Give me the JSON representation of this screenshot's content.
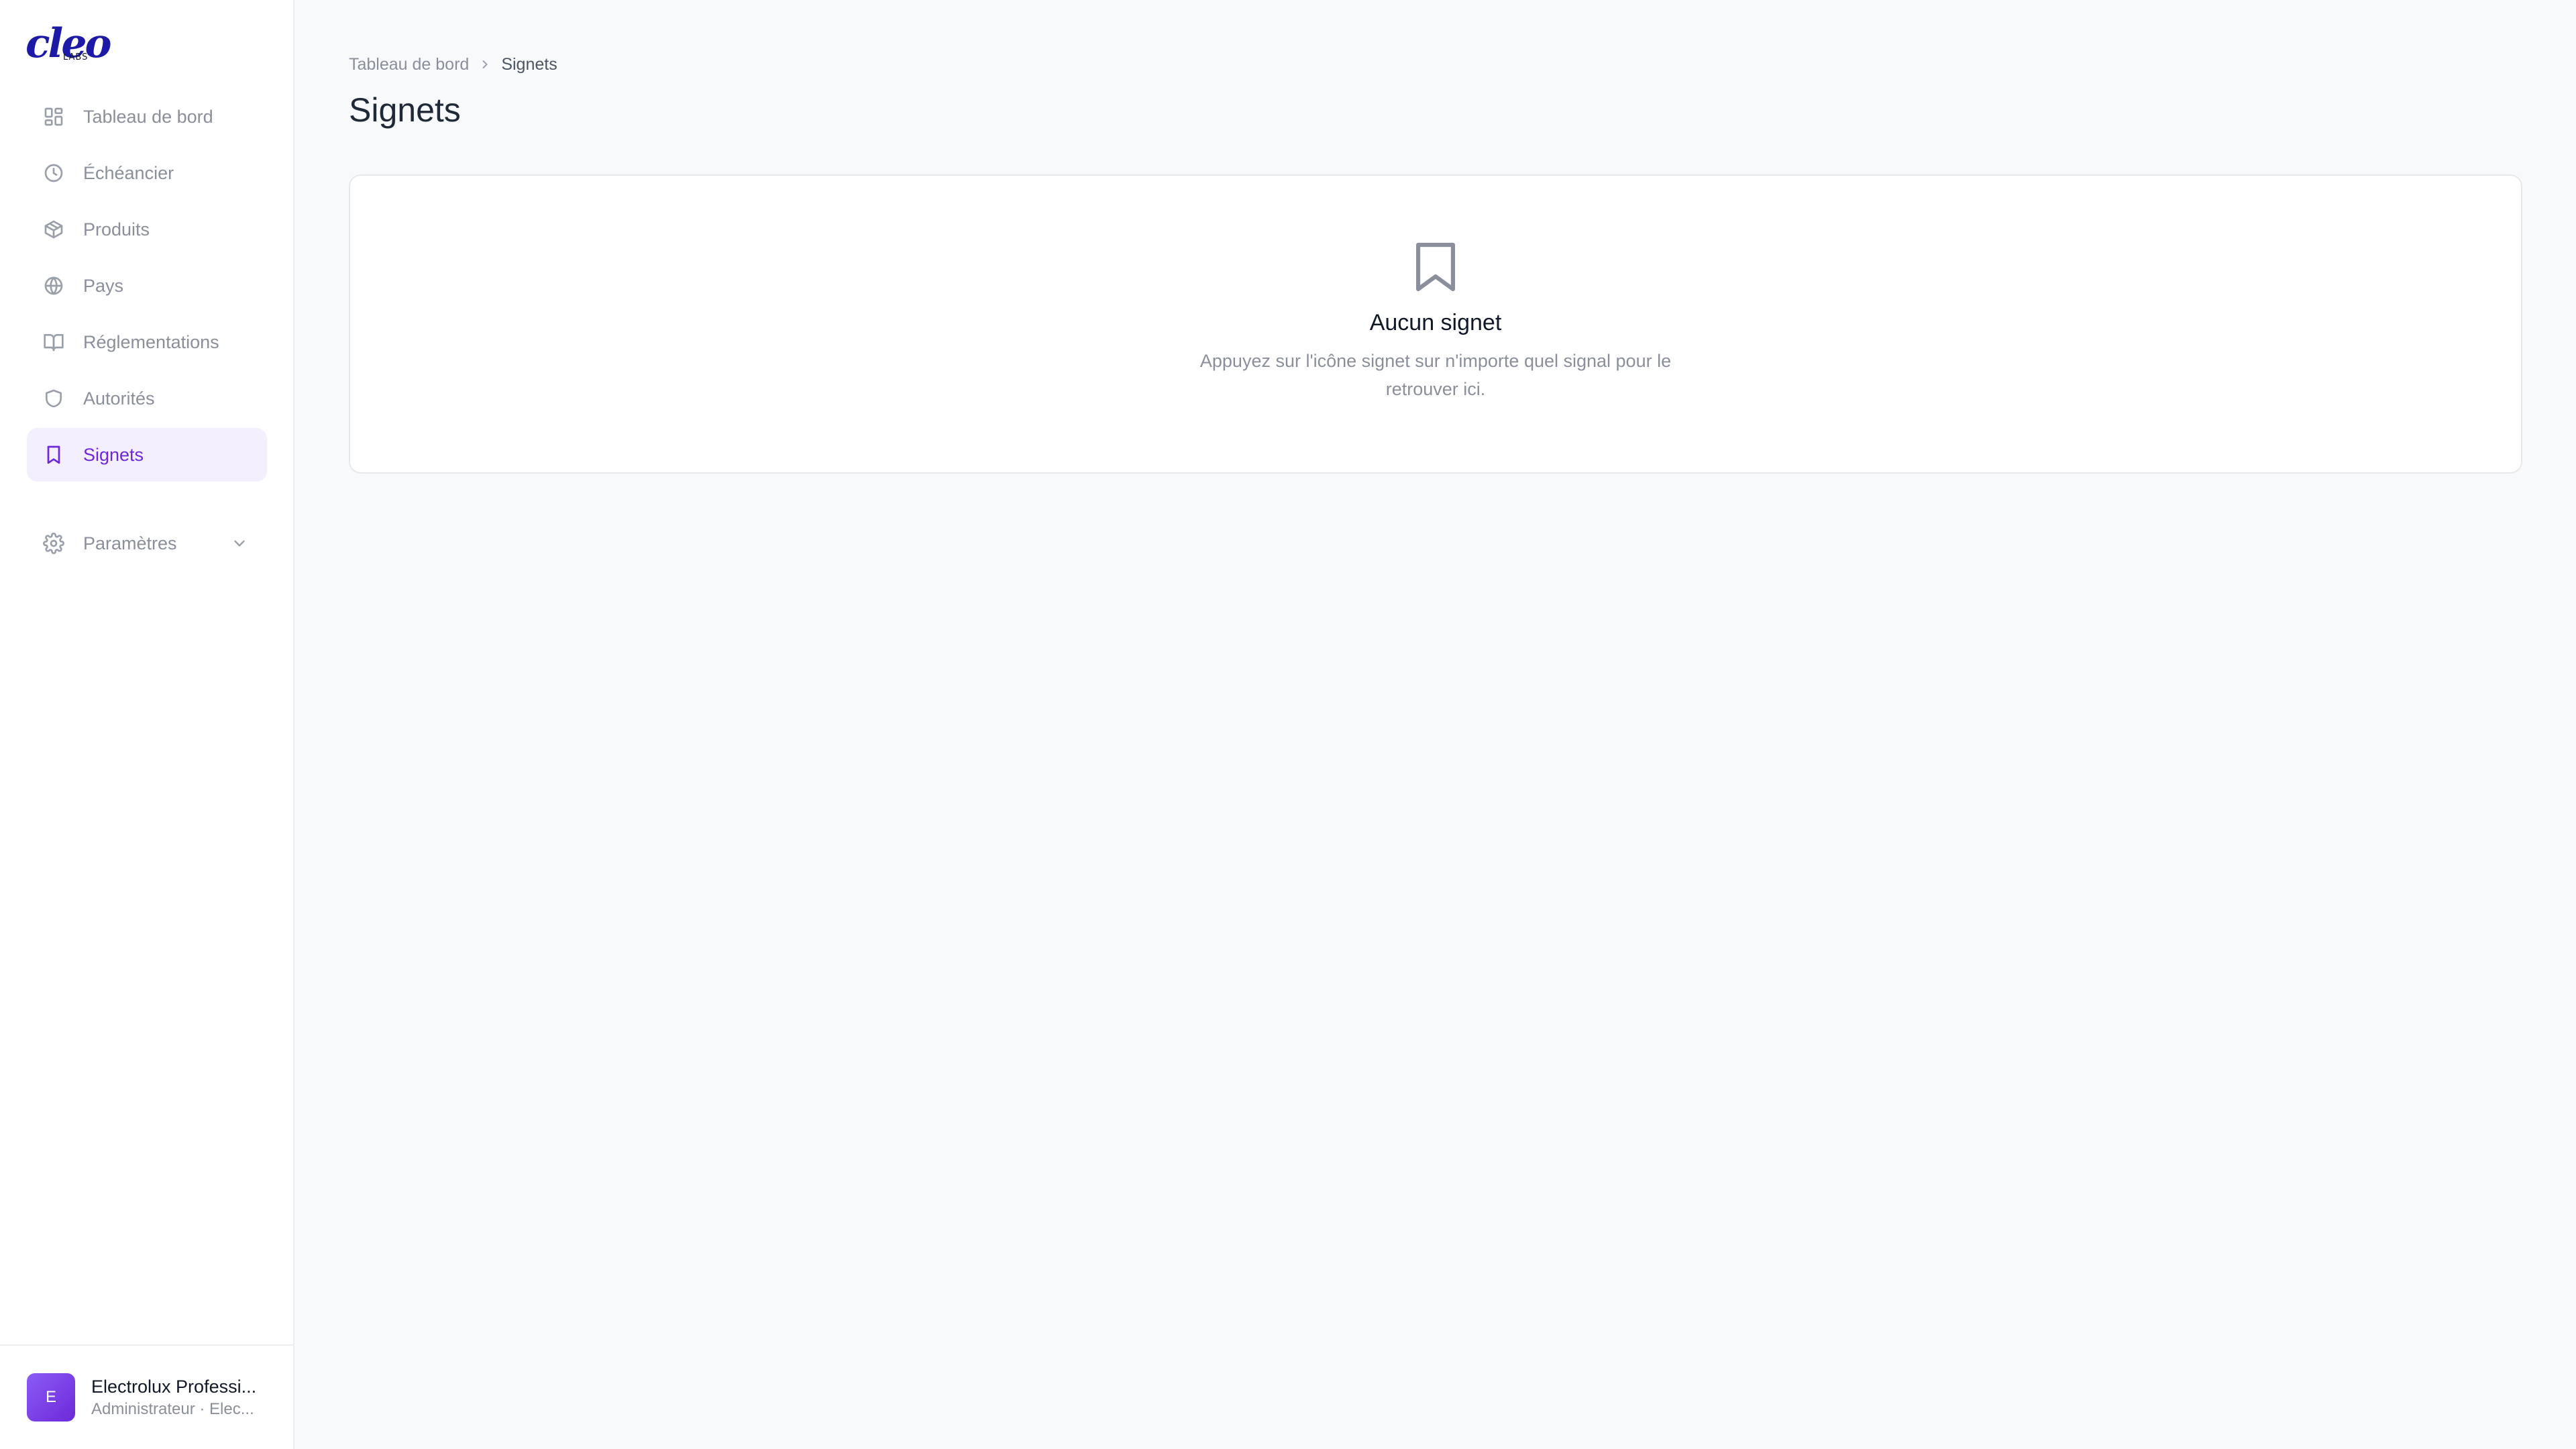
{
  "brand": {
    "logo_text": "cleo",
    "logo_sub": "LABS"
  },
  "sidebar": {
    "items": [
      {
        "label": "Tableau de bord",
        "icon": "dashboard-icon",
        "active": false
      },
      {
        "label": "Échéancier",
        "icon": "clock-icon",
        "active": false
      },
      {
        "label": "Produits",
        "icon": "package-icon",
        "active": false
      },
      {
        "label": "Pays",
        "icon": "globe-icon",
        "active": false
      },
      {
        "label": "Réglementations",
        "icon": "book-icon",
        "active": false
      },
      {
        "label": "Autorités",
        "icon": "shield-icon",
        "active": false
      },
      {
        "label": "Signets",
        "icon": "bookmark-icon",
        "active": true
      }
    ],
    "settings": {
      "label": "Paramètres",
      "icon": "gear-icon",
      "expand_icon": "chevron-down-icon"
    }
  },
  "user": {
    "initial": "E",
    "name": "Electrolux Professi...",
    "role": "Administrateur · Elec..."
  },
  "breadcrumb": {
    "parent": "Tableau de bord",
    "current": "Signets"
  },
  "page": {
    "title": "Signets"
  },
  "empty_state": {
    "icon": "bookmark-icon",
    "title": "Aucun signet",
    "description": "Appuyez sur l'icône signet sur n'importe quel signal pour le retrouver ici."
  },
  "colors": {
    "accent": "#6d28d9",
    "active_bg": "#f3efff",
    "brand": "#1e1aa8",
    "page_bg": "#f8f9fb"
  }
}
